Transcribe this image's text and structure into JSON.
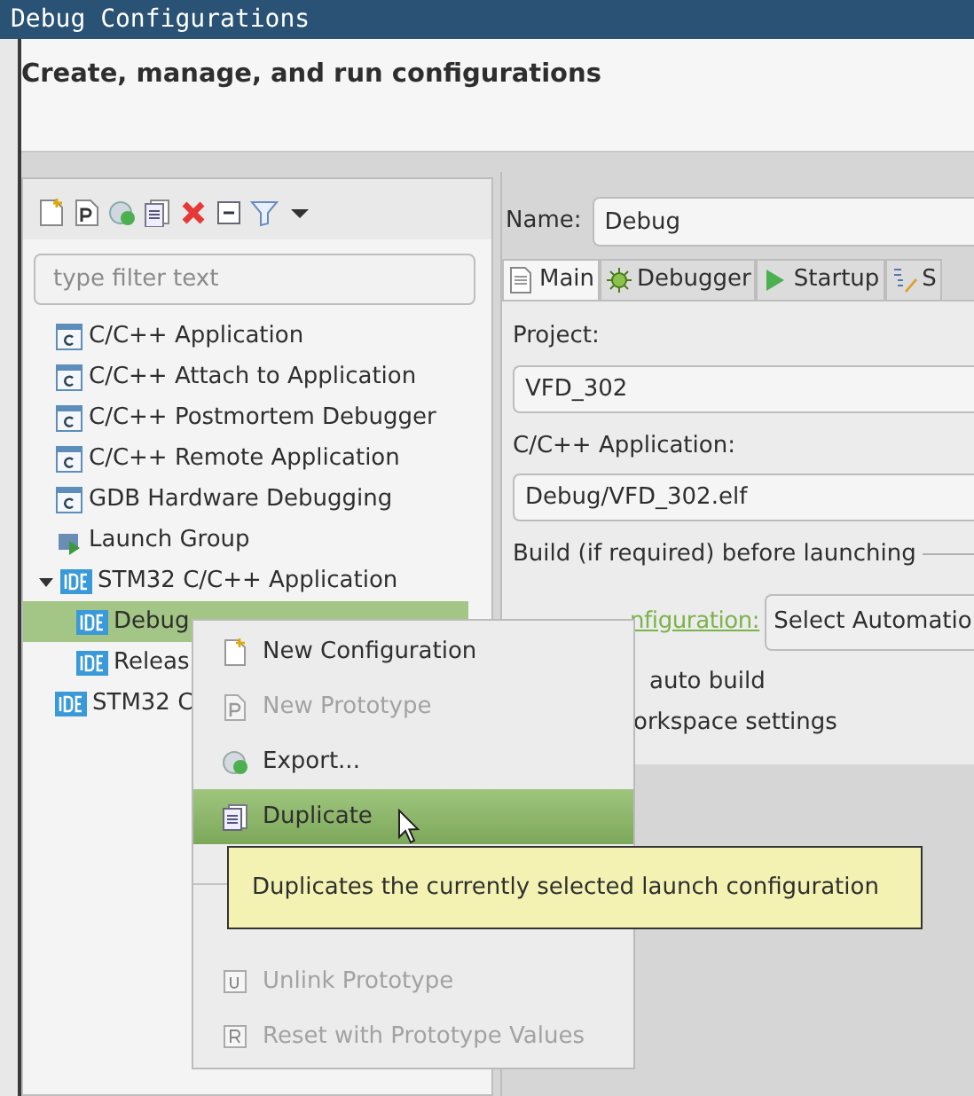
{
  "window": {
    "title": "Debug Configurations"
  },
  "header": {
    "title": "Create, manage, and run configurations"
  },
  "filter": {
    "placeholder": "type filter text"
  },
  "tree": [
    {
      "label": "C/C++ Application",
      "kind": "c",
      "selected": false
    },
    {
      "label": "C/C++ Attach to Application",
      "kind": "c",
      "selected": false
    },
    {
      "label": "C/C++ Postmortem Debugger",
      "kind": "c",
      "selected": false
    },
    {
      "label": "C/C++ Remote Application",
      "kind": "c",
      "selected": false
    },
    {
      "label": "GDB Hardware Debugging",
      "kind": "c",
      "selected": false
    },
    {
      "label": "Launch Group",
      "kind": "group",
      "selected": false
    },
    {
      "label": "STM32 C/C++ Application",
      "kind": "ide",
      "selected": false,
      "expanded": true,
      "children": [
        {
          "label": "Debug",
          "kind": "ide",
          "selected": true
        },
        {
          "label": "Releas",
          "kind": "ide",
          "selected": false
        }
      ]
    },
    {
      "label": "STM32 C",
      "kind": "ide",
      "selected": false
    }
  ],
  "name_field": {
    "label": "Name:",
    "value": "Debug"
  },
  "tabs": [
    {
      "label": "Main",
      "kind": "doc",
      "selected": true
    },
    {
      "label": "Debugger",
      "kind": "bug",
      "selected": false
    },
    {
      "label": "Startup",
      "kind": "play",
      "selected": false
    },
    {
      "label": "S",
      "kind": "source",
      "selected": false
    }
  ],
  "main": {
    "project_label": "Project:",
    "project_value": "VFD_302",
    "app_label": "C/C++ Application:",
    "app_value": "Debug/VFD_302.elf",
    "build_group": "Build (if required) before launching",
    "config_link": "nfiguration:",
    "config_button": "Select Automatio",
    "option_1": "auto build",
    "option_2": "orkspace settings"
  },
  "context_menu": {
    "items": [
      {
        "label": "New Configuration",
        "kind": "new",
        "disabled": false,
        "selected": false
      },
      {
        "label": "New Prototype",
        "kind": "proto",
        "disabled": true,
        "selected": false
      },
      {
        "label": "Export...",
        "kind": "export",
        "disabled": false,
        "selected": false
      },
      {
        "label": "Duplicate",
        "kind": "copy",
        "disabled": false,
        "selected": true
      },
      {
        "kind": "hidden"
      },
      {
        "label": "Unlink Prototype",
        "kind": "unlink",
        "disabled": true,
        "selected": false
      },
      {
        "label": "Reset with Prototype Values",
        "kind": "reset",
        "disabled": true,
        "selected": false
      }
    ]
  },
  "tooltip": {
    "text": "Duplicates the currently selected launch configuration"
  }
}
